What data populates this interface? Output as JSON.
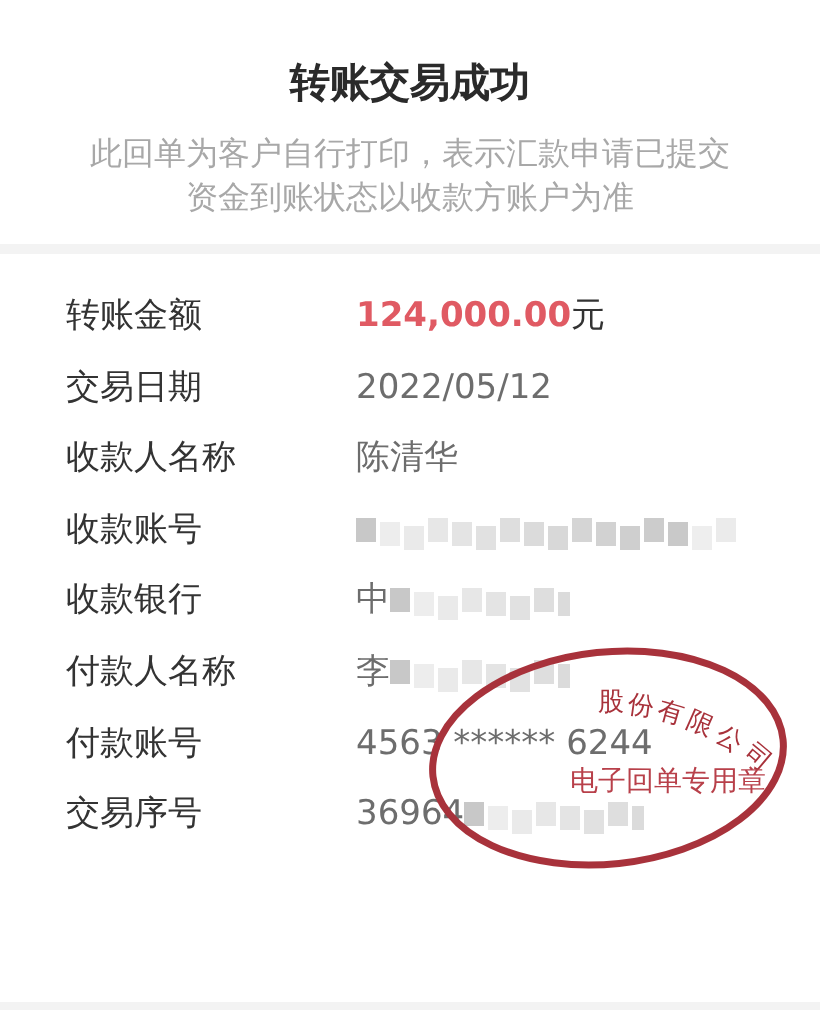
{
  "title": "转账交易成功",
  "notice_lines": [
    "此回单为客户自行打印，表示汇款申请已提交",
    "资金到账状态以收款方账户为准"
  ],
  "rows": [
    {
      "label": "转账金额",
      "kind": "amount",
      "amount": "124,000.00",
      "unit": "元"
    },
    {
      "label": "交易日期",
      "kind": "text",
      "value": "2022/05/12"
    },
    {
      "label": "收款人名称",
      "kind": "text",
      "value": "陈清华"
    },
    {
      "label": "收款账号",
      "kind": "masked",
      "value": ""
    },
    {
      "label": "收款银行",
      "kind": "masked",
      "value": "中"
    },
    {
      "label": "付款人名称",
      "kind": "masked",
      "value": "李"
    },
    {
      "label": "付款账号",
      "kind": "text",
      "value": "4563 ****** 6244"
    },
    {
      "label": "交易序号",
      "kind": "masked",
      "value": "36964"
    }
  ],
  "stamp": {
    "arc_text": "股份有限公司",
    "center_text": "电子回单专用章"
  }
}
